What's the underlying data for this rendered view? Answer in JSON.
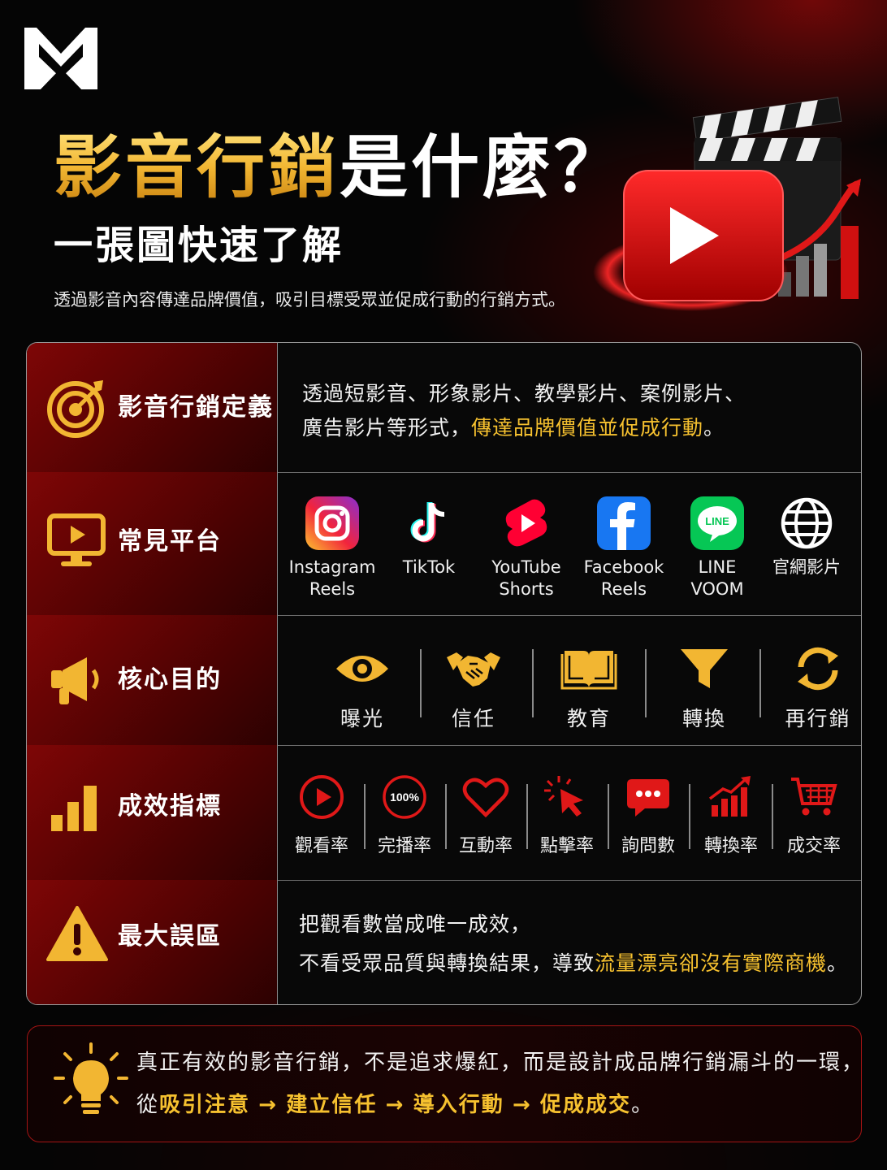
{
  "header": {
    "title_highlight": "影音行銷",
    "title_rest": "是什麼？",
    "subtitle": "一張圖快速了解",
    "description": "透過影音內容傳達品牌價值，吸引目標受眾並促成行動的行銷方式。"
  },
  "colors": {
    "gold": "#f6c12f",
    "brand_red": "#c8102e",
    "label_bg": "#7e0606"
  },
  "rows": {
    "definition": {
      "label": "影音行銷定義",
      "icon": "target-icon",
      "line1": "透過短影音、形象影片、教學影片、案例影片、",
      "line2_prefix": "廣告影片等形式，",
      "line2_highlight": "傳達品牌價值並促成行動",
      "line2_suffix": "。"
    },
    "platforms": {
      "label": "常見平台",
      "icon": "monitor-play-icon",
      "items": [
        {
          "icon": "instagram-icon",
          "line1": "Instagram",
          "line2": "Reels"
        },
        {
          "icon": "tiktok-icon",
          "line1": "TikTok",
          "line2": ""
        },
        {
          "icon": "youtube-shorts-icon",
          "line1": "YouTube",
          "line2": "Shorts"
        },
        {
          "icon": "facebook-icon",
          "line1": "Facebook",
          "line2": "Reels"
        },
        {
          "icon": "line-icon",
          "line1": "LINE",
          "line2": "VOOM"
        },
        {
          "icon": "globe-icon",
          "line1": "官網影片",
          "line2": ""
        }
      ]
    },
    "goals": {
      "label": "核心目的",
      "icon": "megaphone-icon",
      "items": [
        {
          "icon": "eye-icon",
          "label": "曝光"
        },
        {
          "icon": "handshake-icon",
          "label": "信任"
        },
        {
          "icon": "book-icon",
          "label": "教育"
        },
        {
          "icon": "funnel-icon",
          "label": "轉換"
        },
        {
          "icon": "refresh-icon",
          "label": "再行銷"
        }
      ]
    },
    "metrics": {
      "label": "成效指標",
      "icon": "bar-chart-icon",
      "items": [
        {
          "icon": "play-circle-icon",
          "label": "觀看率"
        },
        {
          "icon": "percent-100-icon",
          "label": "完播率",
          "badge": "100%"
        },
        {
          "icon": "heart-icon",
          "label": "互動率"
        },
        {
          "icon": "cursor-click-icon",
          "label": "點擊率"
        },
        {
          "icon": "chat-bubble-icon",
          "label": "詢問數"
        },
        {
          "icon": "growth-chart-icon",
          "label": "轉換率"
        },
        {
          "icon": "cart-icon",
          "label": "成交率"
        }
      ]
    },
    "pitfall": {
      "label": "最大誤區",
      "icon": "warning-icon",
      "line1": "把觀看數當成唯一成效，",
      "line2_prefix": "不看受眾品質與轉換結果，導致",
      "line2_highlight": "流量漂亮卻沒有實際商機",
      "line2_suffix": "。"
    }
  },
  "tip": {
    "icon": "lightbulb-icon",
    "line1": "真正有效的影音行銷，不是追求爆紅，而是設計成品牌行銷漏斗的一環，",
    "line2_prefix": "從",
    "steps": [
      "吸引注意",
      "建立信任",
      "導入行動",
      "促成成交"
    ],
    "arrow": "→",
    "line2_suffix": "。"
  }
}
